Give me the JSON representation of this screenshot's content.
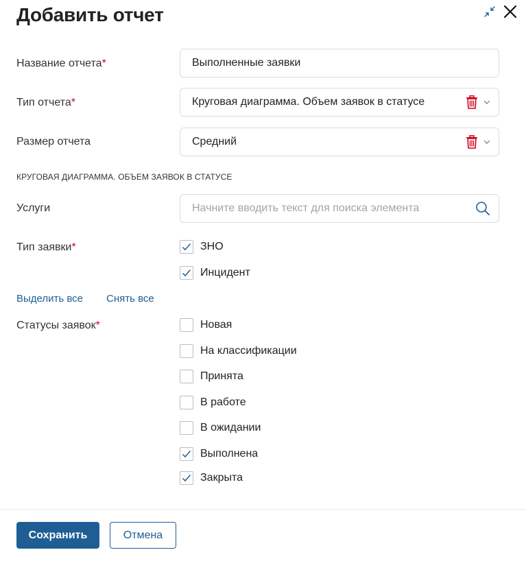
{
  "dialog": {
    "title": "Добавить отчет",
    "icons": {
      "collapse": "collapse-arrows-icon",
      "close": "close-icon"
    }
  },
  "form": {
    "report_name": {
      "label": "Название отчета",
      "required_mark": "*",
      "value": "Выполненные заявки"
    },
    "report_type": {
      "label": "Тип отчета",
      "required_mark": "*",
      "value": "Круговая диаграмма. Объем заявок в статусе"
    },
    "report_size": {
      "label": "Размер отчета",
      "value": "Средний"
    },
    "section_caption": "КРУГОВАЯ ДИАГРАММА. ОБЪЕМ ЗАЯВОК В СТАТУСЕ",
    "services": {
      "label": "Услуги",
      "placeholder": "Начните вводить текст для поиска элемента"
    },
    "request_type": {
      "label": "Тип заявки",
      "required_mark": "*",
      "options": [
        {
          "label": "ЗНО",
          "checked": true
        },
        {
          "label": "Инцидент",
          "checked": true
        }
      ]
    },
    "select_all": "Выделить все",
    "deselect_all": "Снять все",
    "statuses": {
      "label": "Статусы заявок",
      "required_mark": "*",
      "options": [
        {
          "label": "Новая",
          "checked": false
        },
        {
          "label": "На классификации",
          "checked": false
        },
        {
          "label": "Принята",
          "checked": false
        },
        {
          "label": "В работе",
          "checked": false
        },
        {
          "label": "В ожидании",
          "checked": false
        },
        {
          "label": "Выполнена",
          "checked": true
        },
        {
          "label": "Закрыта",
          "checked": true
        }
      ]
    }
  },
  "footer": {
    "save": "Сохранить",
    "cancel": "Отмена"
  },
  "colors": {
    "accent": "#1f5e94",
    "link": "#1d5f93",
    "required": "#d0021b",
    "trash": "#d0021b",
    "check": "#1f5e94"
  }
}
